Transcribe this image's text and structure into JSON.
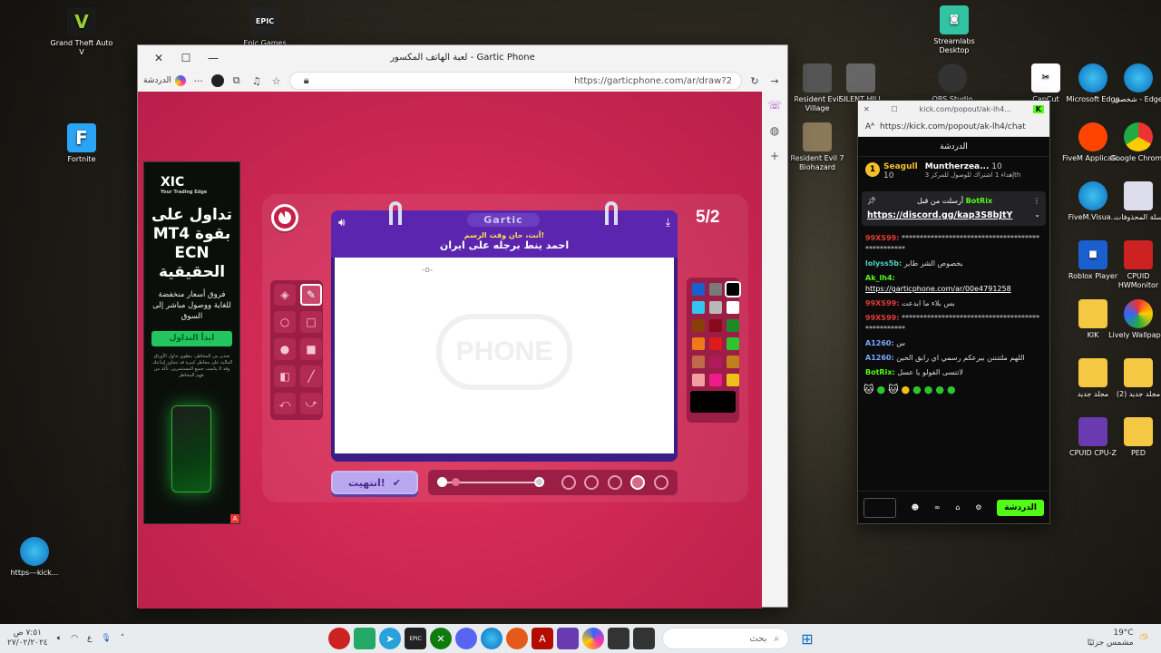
{
  "desktop": {
    "left_icons": [
      {
        "label": "Grand Theft Auto V",
        "icon": "gta-icon"
      },
      {
        "label": "Fortnite",
        "icon": "fortnite-icon"
      },
      {
        "label": "https---kick...",
        "icon": "edge-icon"
      }
    ],
    "top_icons": [
      {
        "label": "Epic Games",
        "icon": "epic-icon"
      },
      {
        "label": "Streamlabs Desktop",
        "icon": "streamlabs-icon"
      }
    ],
    "right_icons": [
      {
        "label": "Resident Evil Village"
      },
      {
        "label": "SILENT HILL"
      },
      {
        "label": "OBS Studio"
      },
      {
        "label": "CapCut"
      },
      {
        "label": "Microsoft Edge"
      },
      {
        "label": "شخصي - Edge"
      },
      {
        "label": "Resident Evil 7 Biohazard"
      },
      {
        "label": "FiveM Applicati..."
      },
      {
        "label": "Google Chrome"
      },
      {
        "label": "سلة المحذوفات"
      },
      {
        "label": "FiveM.Visua..."
      },
      {
        "label": "Roblox Player"
      },
      {
        "label": "CPUID HWMonitor"
      },
      {
        "label": "KIK"
      },
      {
        "label": "Lively Wallpaper"
      },
      {
        "label": "مجلد جديد"
      },
      {
        "label": "مجلد جديد (2)"
      },
      {
        "label": "CPUID CPU-Z"
      },
      {
        "label": "PED"
      }
    ]
  },
  "browser": {
    "title": "لعبة الهاتف المكسور - Gartic Phone",
    "chat_chip": "الدردشة",
    "url": "https://garticphone.com/ar/draw?2",
    "ad": {
      "brand": "XIC",
      "tagline": "Your Trading Edge",
      "headline": "تداول على MT4 بقوة ECN الحقيقية",
      "sub": "فروق أسعار منخفضة للغاية ووصول مباشر إلى السوق",
      "cta": "ابدأ التداول",
      "fine": "تحذير من المخاطر: ينطوي تداول الأوراق المالية على مخاطر كبيرة قد تتجاوز إيداعك. وقد لا يناسب جميع المستثمرين. تأكد من فهم المخاطر."
    },
    "game": {
      "round": "5/2",
      "brand": "Gartic",
      "subtitle": "أنت، حان وقت الرسم!",
      "prompt": "احمد ينط برجله على ايران",
      "watermark": "PHONE",
      "done_label": "انتهيت!",
      "palette": [
        "#1a5fd0",
        "#7a7a7a",
        "#000000",
        "#35c4f0",
        "#b8b8b8",
        "#ffffff",
        "#8a3f0a",
        "#8b0a1a",
        "#1a8a2a",
        "#f07a1a",
        "#e01a1a",
        "#2ec42e",
        "#c06a4a",
        "#b01a5a",
        "#c0801a",
        "#f0a0a0",
        "#f01a8a",
        "#f0c01a"
      ],
      "selected_color": "#000000"
    }
  },
  "kick": {
    "title": "kick.com/popout/ak-lh4...",
    "url": "https://kick.com/popout/ak-lh4/chat",
    "header": "الدردشة",
    "leaderboard": [
      {
        "rank": "1",
        "name": "Seagull",
        "count": "10"
      },
      {
        "name": "Muntherzea...",
        "count": "10",
        "note": "إهداء 1 اشتراك للوصول للمركز 3th"
      }
    ],
    "pinned_by": "أرسلت من قبل",
    "pinned_user": "BotRix",
    "pinned_link": "https://discord.gg/kap3S8bJtY",
    "messages": [
      {
        "user": "99XS99:",
        "color": "#e53935",
        "text": "*************************************************"
      },
      {
        "user": "lolyss5b:",
        "color": "#4fd1c5",
        "text": "بخصوص الشر طاير"
      },
      {
        "user": "Ak_lh4:",
        "color": "#53fc18",
        "text": "https://garticphone.com/ar/00e4791258"
      },
      {
        "user": "99XS99:",
        "color": "#e53935",
        "text": "بس بلاء ما ابدعت"
      },
      {
        "user": "99XS99:",
        "color": "#e53935",
        "text": "*************************************************"
      },
      {
        "user": "A1260:",
        "color": "#7aa7ff",
        "text": "س"
      },
      {
        "user": "A1260:",
        "color": "#7aa7ff",
        "text": "اللهم ملتنننن بيرعكم رسمي اي رابق الحين"
      },
      {
        "user": "BotRix:",
        "color": "#53fc18",
        "text": "لاتنسى الفولو يا عسل"
      }
    ],
    "chat_button": "الدردشة"
  },
  "taskbar": {
    "search_placeholder": "بحث",
    "weather_temp": "19°C",
    "weather_desc": "مشمس جزئيًا",
    "time": "٧:٥١ ص",
    "date": "٢٧/٠٢/٢٠٢٤",
    "lang": "ع"
  }
}
